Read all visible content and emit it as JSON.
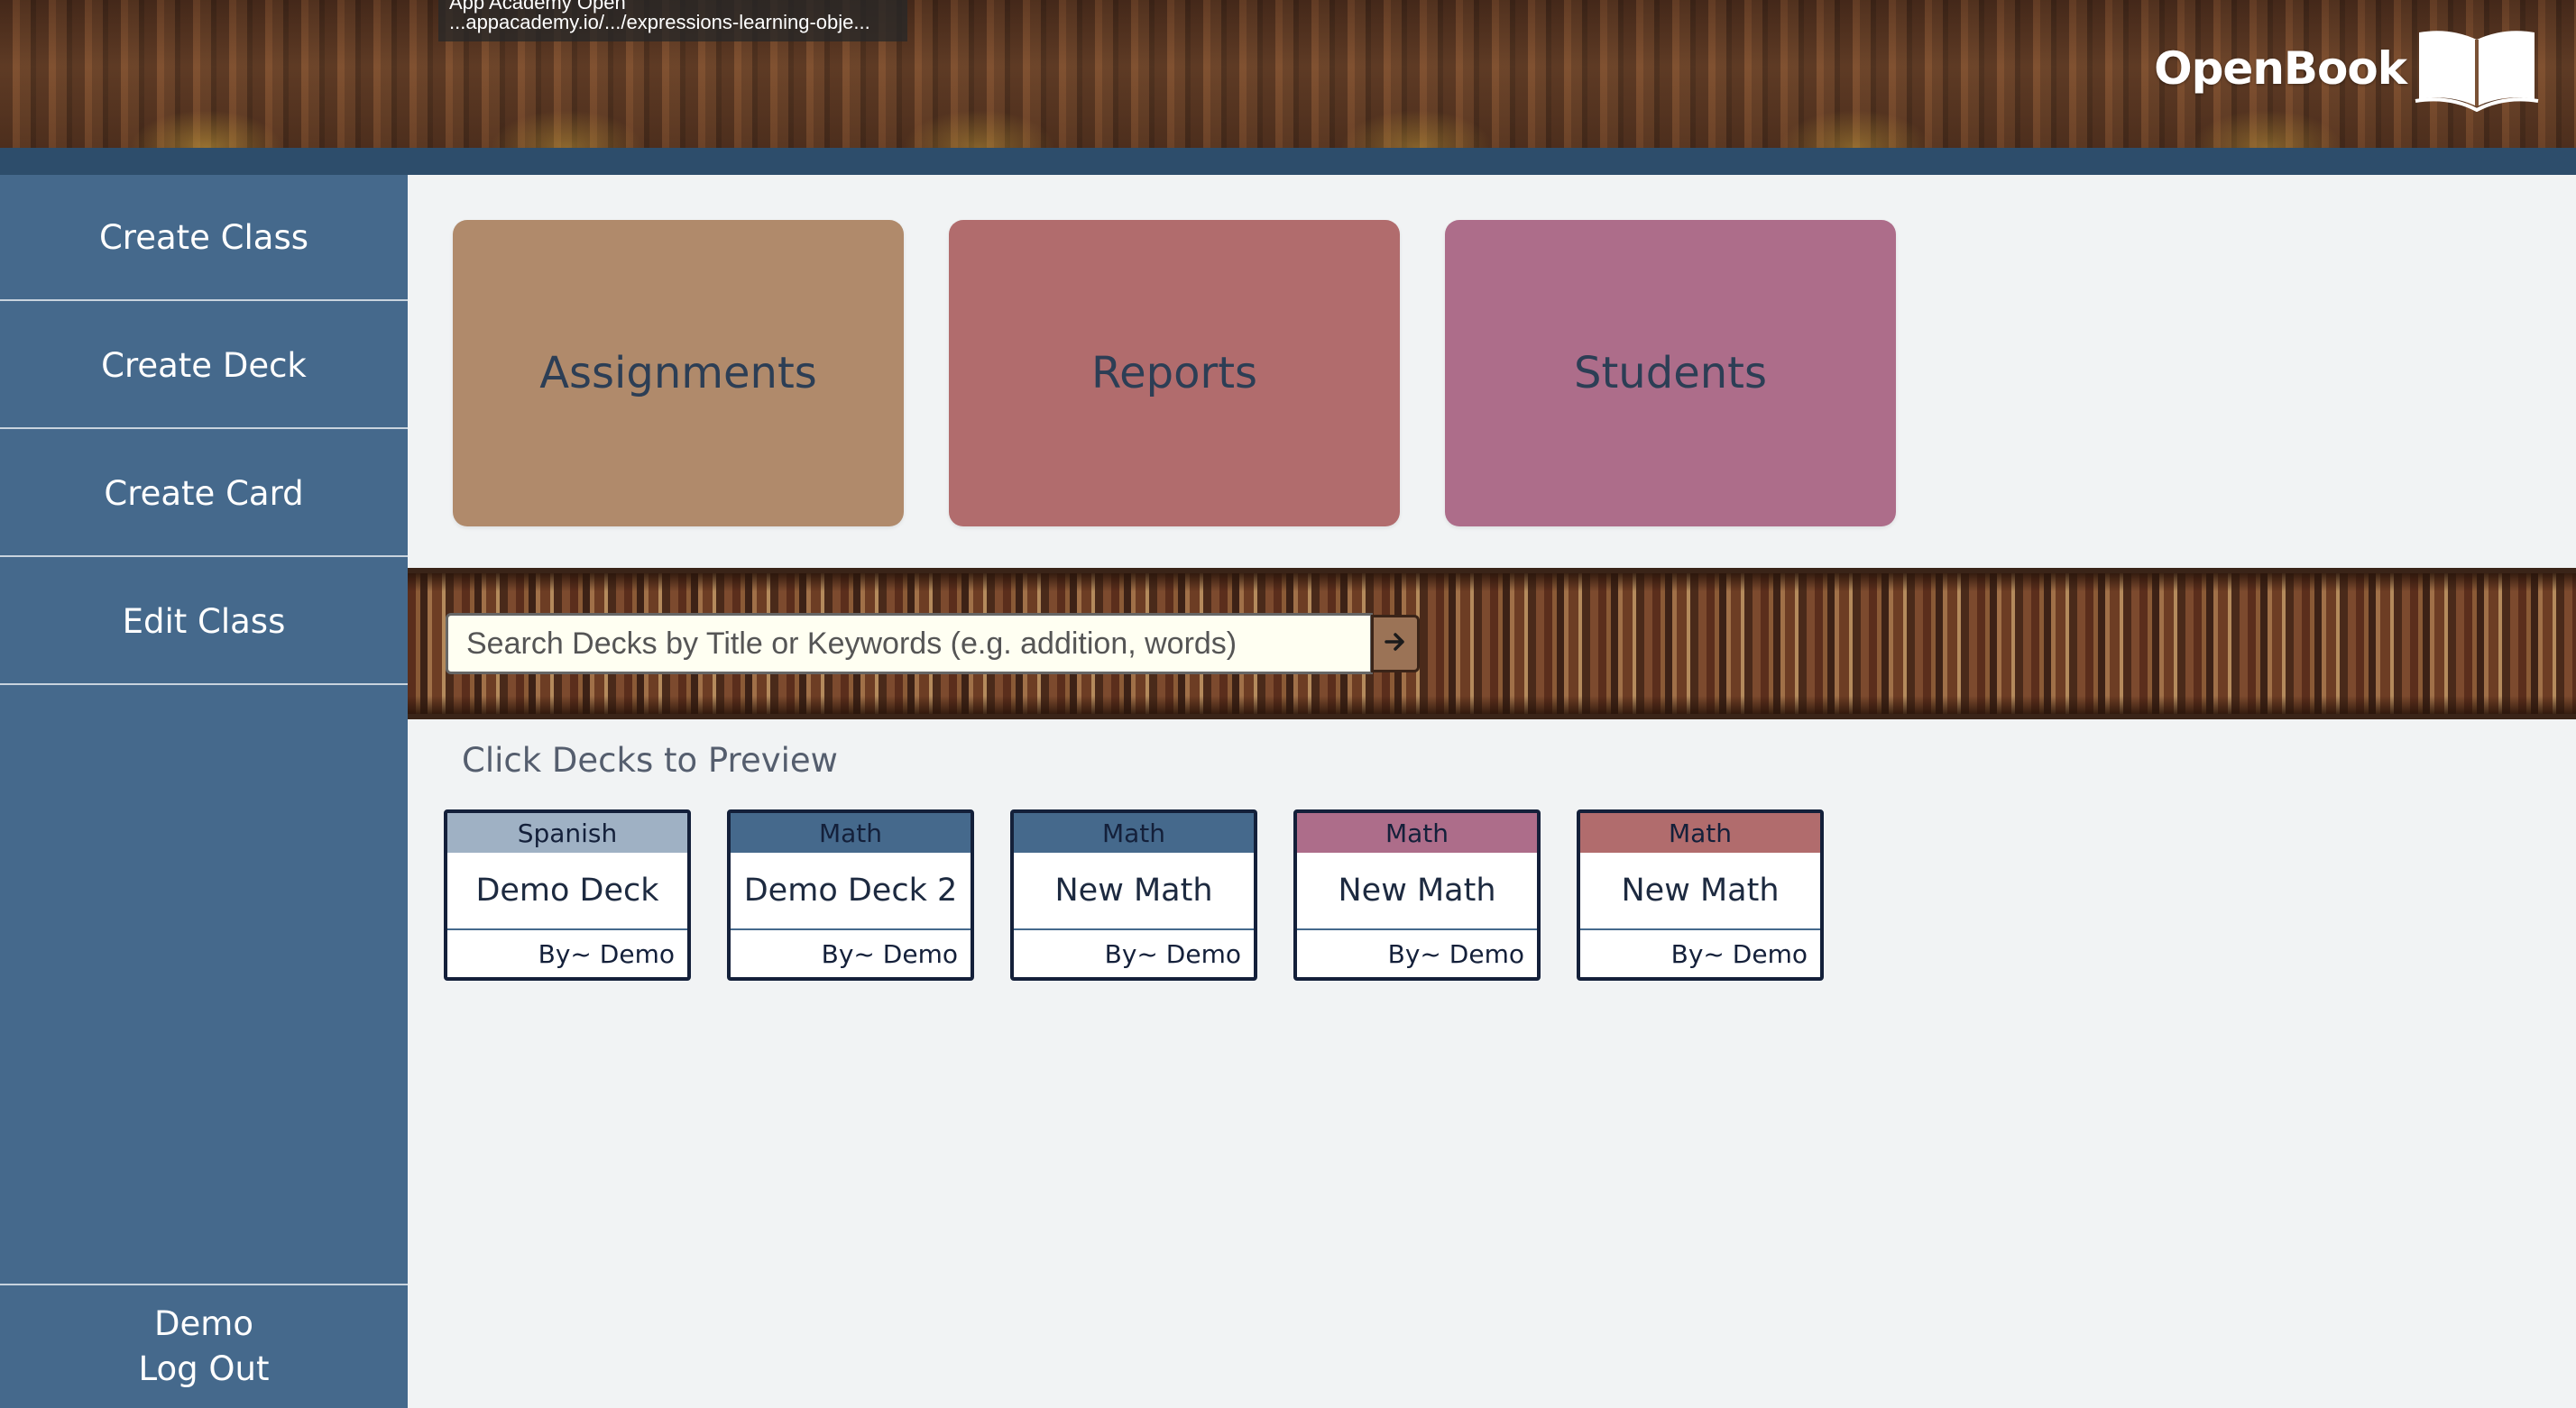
{
  "browser": {
    "tooltip_title": "App Academy Open",
    "tooltip_url": "...appacademy.io/.../expressions-learning-obje..."
  },
  "brand": {
    "name": "OpenBook",
    "icon": "open-book-icon"
  },
  "sidebar": {
    "items": [
      {
        "label": "Create Class"
      },
      {
        "label": "Create Deck"
      },
      {
        "label": "Create Card"
      },
      {
        "label": "Edit Class"
      }
    ],
    "user_name": "Demo",
    "logout_label": "Log Out"
  },
  "tiles": [
    {
      "label": "Assignments",
      "color": "#b08a6b"
    },
    {
      "label": "Reports",
      "color": "#b16c6d"
    },
    {
      "label": "Students",
      "color": "#ad6d8a"
    }
  ],
  "search": {
    "placeholder": "Search Decks by Title or Keywords (e.g. addition, words)",
    "submit_icon": "arrow-right-icon"
  },
  "decks_section": {
    "label": "Click Decks to Preview",
    "decks": [
      {
        "subject": "Spanish",
        "title": "Demo Deck",
        "author": "By~ Demo",
        "color": "#9fb1c4"
      },
      {
        "subject": "Math",
        "title": "Demo Deck 2",
        "author": "By~ Demo",
        "color": "#45698c"
      },
      {
        "subject": "Math",
        "title": "New Math",
        "author": "By~ Demo",
        "color": "#45698c"
      },
      {
        "subject": "Math",
        "title": "New Math",
        "author": "By~ Demo",
        "color": "#ad6d8a"
      },
      {
        "subject": "Math",
        "title": "New Math",
        "author": "By~ Demo",
        "color": "#b16c6d"
      }
    ]
  }
}
